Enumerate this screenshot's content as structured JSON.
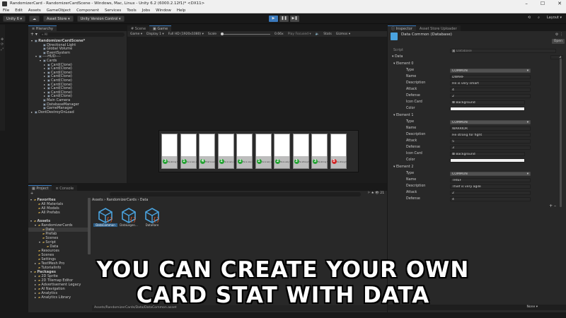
{
  "window": {
    "title": "RandomizerCard - RandomizerCardScene - Windows, Mac, Linux - Unity 6.2 (6000.2.12f1)* <DX11>",
    "min": "–",
    "max": "☐",
    "close": "✕"
  },
  "menu": [
    "File",
    "Edit",
    "Assets",
    "GameObject",
    "Component",
    "Services",
    "Tools",
    "Jobs",
    "Window",
    "Help"
  ],
  "toolbar": {
    "account": "Unity 6",
    "asset_store": "Asset Store",
    "version_control": "Unity Version Control",
    "layout": "Layout"
  },
  "hierarchy": {
    "tab": "Hierarchy",
    "search_placeholder": "All",
    "rows": [
      {
        "label": "RandomizerCardScene*",
        "depth": 0,
        "bold": true,
        "arrow": "▾"
      },
      {
        "label": "Directional Light",
        "depth": 2,
        "arrow": ""
      },
      {
        "label": "Global Volume",
        "depth": 2,
        "arrow": ""
      },
      {
        "label": "EventSystem",
        "depth": 2,
        "arrow": ""
      },
      {
        "label": "----HUD----",
        "depth": 1,
        "arrow": "▾"
      },
      {
        "label": "Cards",
        "depth": 2,
        "arrow": "▾"
      },
      {
        "label": "Card(Clone)",
        "depth": 3,
        "arrow": "▸"
      },
      {
        "label": "Card(Clone)",
        "depth": 3,
        "arrow": "▸"
      },
      {
        "label": "Card(Clone)",
        "depth": 3,
        "arrow": "▸"
      },
      {
        "label": "Card(Clone)",
        "depth": 3,
        "arrow": "▸"
      },
      {
        "label": "Card(Clone)",
        "depth": 3,
        "arrow": "▸"
      },
      {
        "label": "Card(Clone)",
        "depth": 3,
        "arrow": "▸"
      },
      {
        "label": "Card(Clone)",
        "depth": 3,
        "arrow": "▸"
      },
      {
        "label": "Card(Clone)",
        "depth": 3,
        "arrow": "▸"
      },
      {
        "label": "Card(Clone)",
        "depth": 3,
        "arrow": "▸"
      },
      {
        "label": "Main Camera",
        "depth": 2,
        "arrow": ""
      },
      {
        "label": "DatabaseManager",
        "depth": 2,
        "arrow": ""
      },
      {
        "label": "GameManager",
        "depth": 2,
        "arrow": ""
      },
      {
        "label": "DontDestroyOnLoad",
        "depth": 0,
        "arrow": "▸"
      }
    ]
  },
  "game": {
    "scene_tab": "Scene",
    "game_tab": "Game",
    "mode": "Game",
    "display": "Display 1",
    "resolution": "Full HD (1920x1080)",
    "scale_label": "Scale",
    "scale_value": "0.66x",
    "play_focused": "Play Focused",
    "stats": "Stats",
    "gizmos": "Gizmos",
    "cards": [
      {
        "num": "3",
        "cap": "He strong fo",
        "red": false
      },
      {
        "num": "1",
        "cap": "He is very s",
        "red": false
      },
      {
        "num": "4",
        "cap": "Thief is ver",
        "red": false
      },
      {
        "num": "1",
        "cap": "He is very s",
        "red": false
      },
      {
        "num": "2",
        "cap": "He is very s",
        "red": false
      },
      {
        "num": "1",
        "cap": "He is very s",
        "red": false
      },
      {
        "num": "2",
        "cap": "He is very s",
        "red": false
      },
      {
        "num": "3",
        "cap": "He strong fo",
        "red": false
      },
      {
        "num": "3",
        "cap": "He strong fo",
        "red": false
      },
      {
        "num": "5",
        "cap": "He strong for fight",
        "red": true
      }
    ]
  },
  "project": {
    "tab": "Project",
    "console_tab": "Console",
    "add": "+",
    "count": "21",
    "tree": [
      {
        "label": "Favorites",
        "depth": 0,
        "bold": true,
        "arrow": "▾"
      },
      {
        "label": "All Materials",
        "depth": 1,
        "arrow": ""
      },
      {
        "label": "All Models",
        "depth": 1,
        "arrow": ""
      },
      {
        "label": "All Prefabs",
        "depth": 1,
        "arrow": ""
      },
      {
        "label": "",
        "depth": 0,
        "arrow": ""
      },
      {
        "label": "Assets",
        "depth": 0,
        "bold": true,
        "arrow": "▾"
      },
      {
        "label": "RandomizerCards",
        "depth": 1,
        "arrow": "▾"
      },
      {
        "label": "Data",
        "depth": 2,
        "arrow": "",
        "sel": true
      },
      {
        "label": "Prefab",
        "depth": 2,
        "arrow": ""
      },
      {
        "label": "Scenes",
        "depth": 2,
        "arrow": ""
      },
      {
        "label": "Script",
        "depth": 2,
        "arrow": "▾"
      },
      {
        "label": "Data",
        "depth": 3,
        "arrow": ""
      },
      {
        "label": "Resources",
        "depth": 1,
        "arrow": ""
      },
      {
        "label": "Scenes",
        "depth": 1,
        "arrow": ""
      },
      {
        "label": "Settings",
        "depth": 1,
        "arrow": ""
      },
      {
        "label": "TextMesh Pro",
        "depth": 1,
        "arrow": "▸"
      },
      {
        "label": "TutorialInfo",
        "depth": 1,
        "arrow": ""
      },
      {
        "label": "Packages",
        "depth": 0,
        "bold": true,
        "arrow": "▾"
      },
      {
        "label": "2D Sprite",
        "depth": 1,
        "arrow": "▸"
      },
      {
        "label": "2D Tilemap Editor",
        "depth": 1,
        "arrow": "▸"
      },
      {
        "label": "Advertisement Legacy",
        "depth": 1,
        "arrow": "▸"
      },
      {
        "label": "AI Navigation",
        "depth": 1,
        "arrow": "▸"
      },
      {
        "label": "Analytics",
        "depth": 1,
        "arrow": "▸"
      },
      {
        "label": "Analytics Library",
        "depth": 1,
        "arrow": "▸"
      }
    ],
    "breadcrumb": [
      "Assets",
      "RandomizerCards",
      "Data"
    ],
    "assets": [
      {
        "label": "DataCommon",
        "sel": true
      },
      {
        "label": "DataLegen...",
        "sel": false
      },
      {
        "label": "DataRare",
        "sel": false
      }
    ],
    "status_path": "Assets/RandomizerCards/Data/DataCommon.asset"
  },
  "inspector": {
    "tab": "Inspector",
    "store_tab": "Asset Store Uploader",
    "title": "Data Common (Database)",
    "open": "Open",
    "script_label": "Script",
    "script_value": "Database",
    "data_label": "Data",
    "data_count": "3",
    "none_label": "None",
    "elements": [
      {
        "header": "Element 0",
        "type": "COMMON",
        "name": "DWARF",
        "description": "He is very smart",
        "attack": "4",
        "defense": "2",
        "icon": "Background"
      },
      {
        "header": "Element 1",
        "type": "COMMON",
        "name": "WARRIOR",
        "description": "He strong for fight",
        "attack": "5",
        "defense": "3",
        "icon": "Background"
      },
      {
        "header": "Element 2",
        "type": "COMMON",
        "name": "THIEF",
        "description": "Thief is very agile",
        "attack": "2",
        "defense": "4"
      }
    ],
    "field_labels": {
      "type": "Type",
      "name": "Name",
      "description": "Description",
      "attack": "Attack",
      "defense": "Defense",
      "icon": "Icon Card",
      "color": "Color"
    }
  },
  "caption": {
    "line1": "YOU CAN CREATE YOUR OWN",
    "line2": "CARD STAT WITH DATA"
  },
  "colors": {
    "accent": "#3a79bb",
    "panel": "#282828",
    "selection": "#2c5d87",
    "green_badge": "#25a233",
    "red_badge": "#d02525",
    "asset_icon": "#4aa3df"
  }
}
